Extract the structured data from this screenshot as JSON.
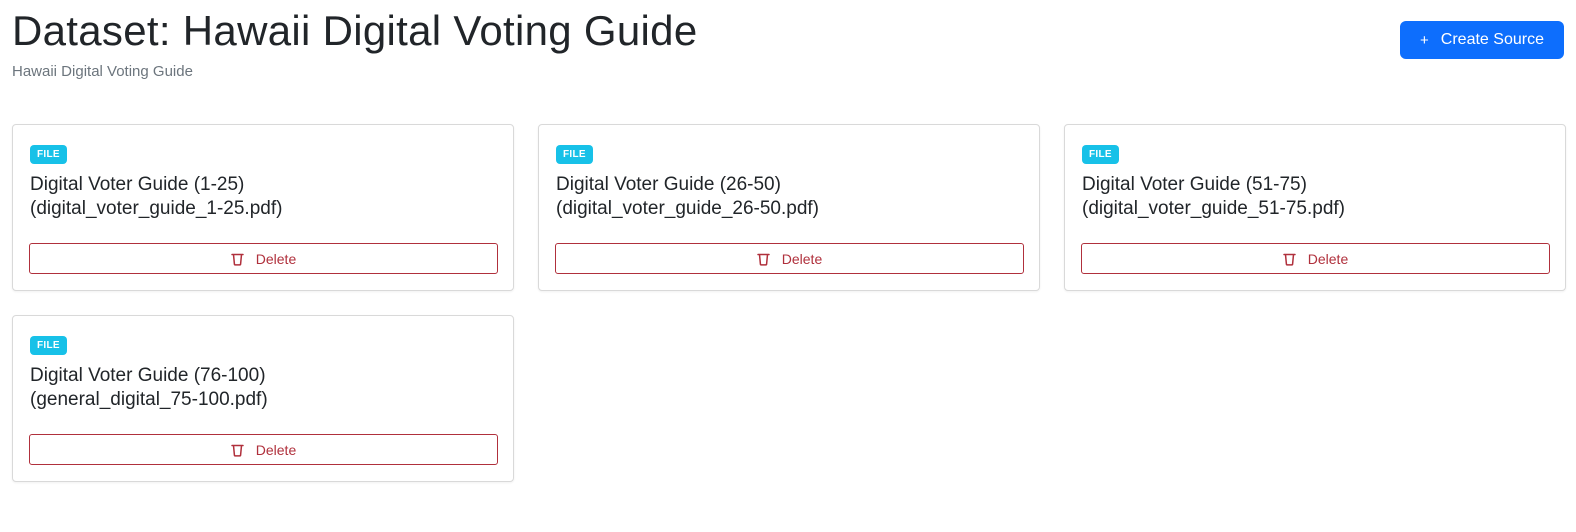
{
  "header": {
    "title": "Dataset: Hawaii Digital Voting Guide",
    "subtitle": "Hawaii Digital Voting Guide"
  },
  "actions": {
    "create_source_label": "Create Source",
    "create_source_icon": "plus-icon"
  },
  "colors": {
    "primary": "#0d6efd",
    "badge": "#17c1e8",
    "danger": "#b0303c"
  },
  "sources": [
    {
      "type": "FILE",
      "title_line1": "Digital Voter Guide (1-25)",
      "title_line2": "(digital_voter_guide_1-25.pdf)",
      "delete_label": "Delete"
    },
    {
      "type": "FILE",
      "title_line1": "Digital Voter Guide (26-50)",
      "title_line2": "(digital_voter_guide_26-50.pdf)",
      "delete_label": "Delete"
    },
    {
      "type": "FILE",
      "title_line1": "Digital Voter Guide (51-75)",
      "title_line2": "(digital_voter_guide_51-75.pdf)",
      "delete_label": "Delete"
    },
    {
      "type": "FILE",
      "title_line1": "Digital Voter Guide (76-100)",
      "title_line2": "(general_digital_75-100.pdf)",
      "delete_label": "Delete"
    }
  ]
}
